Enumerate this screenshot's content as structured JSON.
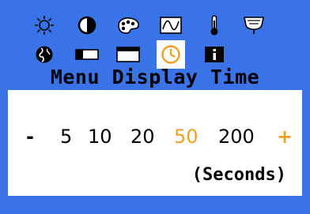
{
  "menu": {
    "row1_icons": [
      {
        "name": "brightness-icon",
        "glyph": "sun"
      },
      {
        "name": "contrast-icon",
        "glyph": "half-circle"
      },
      {
        "name": "color-icon",
        "glyph": "palette"
      },
      {
        "name": "geometry-icon",
        "glyph": "waveform"
      },
      {
        "name": "temperature-icon",
        "glyph": "thermometer"
      },
      {
        "name": "audio-icon",
        "glyph": "speaker"
      }
    ],
    "row2_icons": [
      {
        "name": "language-icon",
        "glyph": "globe"
      },
      {
        "name": "position-icon",
        "glyph": "horizontal-rect"
      },
      {
        "name": "size-icon",
        "glyph": "window"
      },
      {
        "name": "display-time-icon",
        "glyph": "clock",
        "selected": true
      },
      {
        "name": "info-icon",
        "glyph": "info"
      }
    ],
    "title": "Menu Display Time"
  },
  "setting": {
    "decrease_label": "-",
    "increase_label": "+",
    "options": [
      "5",
      "10",
      "20",
      "50",
      "200"
    ],
    "selected": "50",
    "unit": "(Seconds)"
  },
  "colors": {
    "background": "#3a72e8",
    "panel": "#ffffff",
    "accent": "#f0a020",
    "text": "#000000"
  }
}
